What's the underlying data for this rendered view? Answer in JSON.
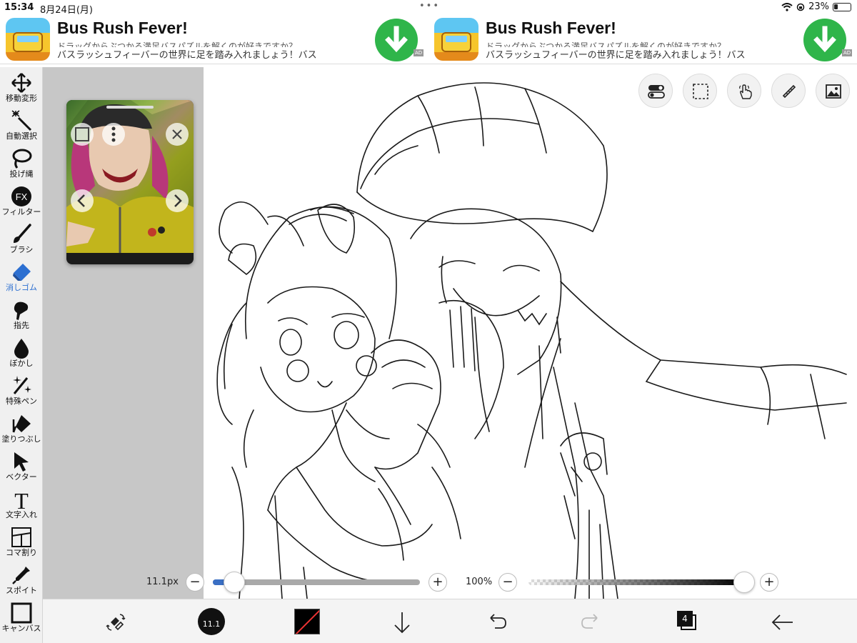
{
  "status": {
    "time": "15:34",
    "date": "8月24日(月)",
    "battery": "23%"
  },
  "ads": [
    {
      "title": "Bus Rush Fever!",
      "line1": "ドラッグからぶつかる満足バスパズルを解くのが好きですか？",
      "line2": "バスラッシュフィーバーの世界に足を踏み入れましょう！バス",
      "badge": "AD"
    },
    {
      "title": "Bus Rush Fever!",
      "line1": "ドラッグからぶつかる満足バスパズルを解くのが好きですか？",
      "line2": "バスラッシュフィーバーの世界に足を踏み入れましょう！バス",
      "badge": "AD"
    }
  ],
  "tools": [
    {
      "label": "移動変形",
      "icon": "move-icon"
    },
    {
      "label": "自動選択",
      "icon": "magic-wand-icon"
    },
    {
      "label": "投げ縄",
      "icon": "lasso-icon"
    },
    {
      "label": "フィルター",
      "icon": "fx-icon",
      "text": "FX"
    },
    {
      "label": "ブラシ",
      "icon": "brush-icon"
    },
    {
      "label": "消しゴム",
      "icon": "eraser-icon",
      "active": true
    },
    {
      "label": "指先",
      "icon": "smudge-icon"
    },
    {
      "label": "ぼかし",
      "icon": "blur-icon"
    },
    {
      "label": "特殊ペン",
      "icon": "special-pen-icon"
    },
    {
      "label": "塗りつぶし",
      "icon": "bucket-icon"
    },
    {
      "label": "ベクター",
      "icon": "vector-icon"
    },
    {
      "label": "文字入れ",
      "icon": "text-icon",
      "text": "T"
    },
    {
      "label": "コマ割り",
      "icon": "frame-divide-icon"
    },
    {
      "label": "スポイト",
      "icon": "eyedropper-icon"
    },
    {
      "label": "キャンバス",
      "icon": "canvas-icon"
    }
  ],
  "sliders": {
    "size_label": "11.1px",
    "size_fraction": 0.08,
    "opacity_label": "100%",
    "opacity_fraction": 1.0
  },
  "bottom": {
    "brush_size": "11.1",
    "layer_count": "4"
  },
  "colors": {
    "accent": "#2c6fd1",
    "slider_fill": "#3a6fc4",
    "download_green": "#2fb54a",
    "primary_color": "#000000"
  }
}
